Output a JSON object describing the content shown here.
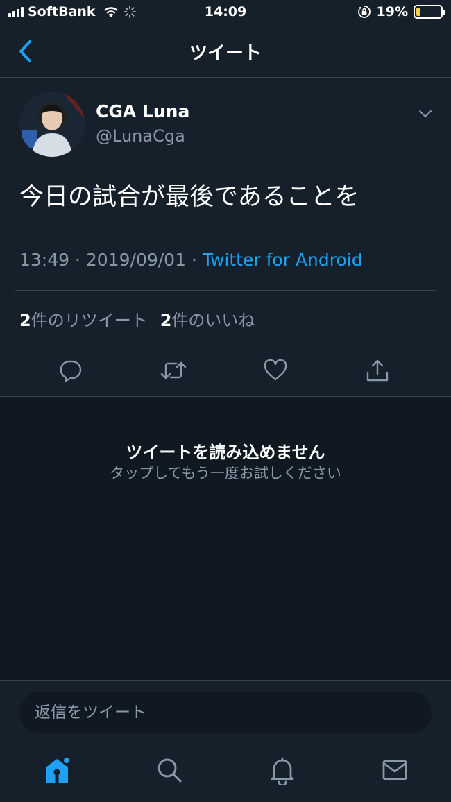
{
  "status_bar": {
    "carrier": "SoftBank",
    "time": "14:09",
    "battery_percent": "19%",
    "battery_level": 0.19
  },
  "nav": {
    "title": "ツイート",
    "back_icon": "chevron-left-icon"
  },
  "tweet": {
    "display_name": "CGA Luna",
    "handle": "@LunaCga",
    "text": "今日の試合が最後であることを",
    "time": "13:49",
    "separator": "·",
    "date": "2019/09/01",
    "source": "Twitter for Android",
    "retweet_count": "2",
    "retweet_label": "件のリツイート",
    "like_count": "2",
    "like_label": "件のいいね",
    "actions": [
      "reply-icon",
      "retweet-icon",
      "heart-icon",
      "share-icon"
    ]
  },
  "error": {
    "title": "ツイートを読み込めません",
    "subtitle": "タップしてもう一度お試しください"
  },
  "reply": {
    "placeholder": "返信をツイート"
  },
  "tab_bar": {
    "tabs": [
      "home-icon",
      "search-icon",
      "bell-icon",
      "mail-icon"
    ],
    "active": "home-icon"
  },
  "colors": {
    "background": "#15202b",
    "accent": "#1da1f2",
    "secondary_text": "#8899a6",
    "divider": "#38444d",
    "battery": "#f7ce46"
  }
}
